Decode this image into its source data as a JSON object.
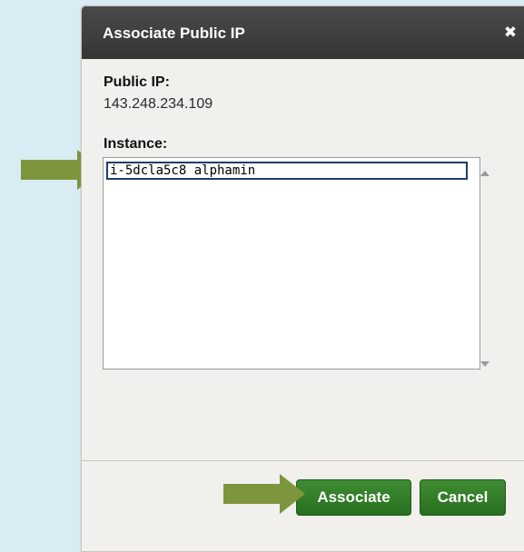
{
  "dialog": {
    "title": "Associate Public IP",
    "close_icon": "close-icon"
  },
  "public_ip": {
    "label": "Public IP:",
    "value": "143.248.234.109"
  },
  "instance": {
    "label": "Instance:",
    "options": [
      "i-5dcla5c8 alphamin"
    ],
    "selected_index": 0
  },
  "buttons": {
    "associate": "Associate",
    "cancel": "Cancel"
  },
  "colors": {
    "titlebar": "#3b3b3b",
    "button_green": "#2f7d26",
    "annotation_arrow": "#7d963d",
    "background": "#d9ebf3"
  }
}
